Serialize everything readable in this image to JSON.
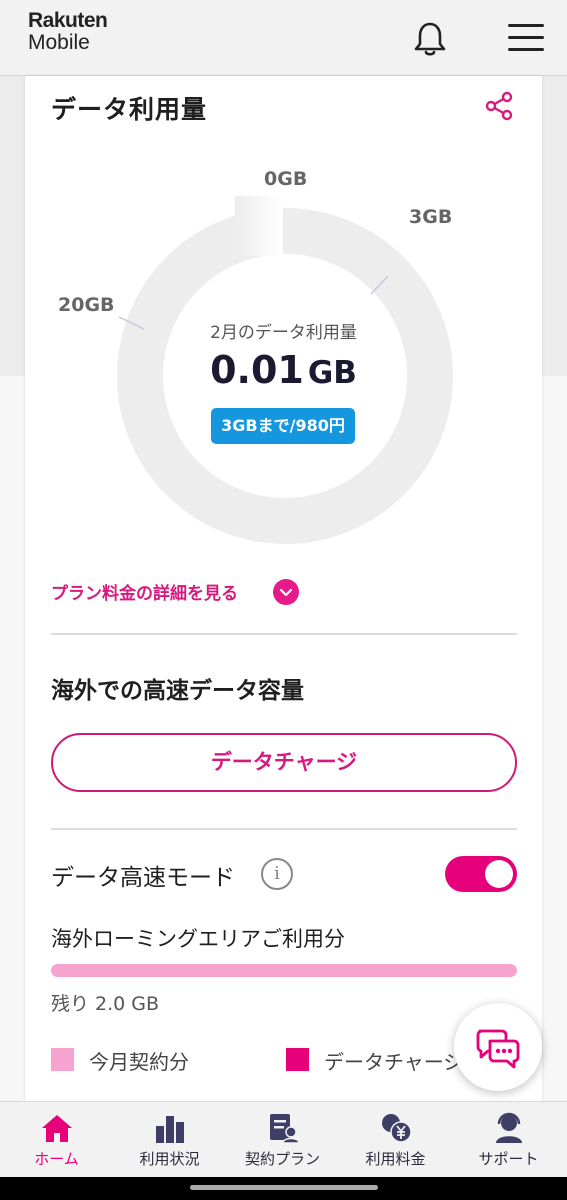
{
  "header": {
    "brand_line1": "Rakuten",
    "brand_line2": "Mobile"
  },
  "usage": {
    "title": "データ利用量",
    "label_zero": "0GB",
    "label_three": "3GB",
    "label_twenty": "20GB",
    "caption": "2月のデータ利用量",
    "value": "0.01",
    "unit": "GB",
    "price_badge": "3GBまで/980円",
    "plan_link": "プラン料金の詳細を見る"
  },
  "overseas": {
    "title": "海外での高速データ容量",
    "charge_button": "データチャージ",
    "mode_label": "データ高速モード",
    "info_glyph": "i",
    "mode_enabled": true,
    "roaming_label": "海外ローミングエリアご利用分",
    "roaming_fill_fraction": 1.0,
    "remaining": "残り 2.0 GB",
    "legend": [
      {
        "label": "今月契約分",
        "color": "#f7a3cf"
      },
      {
        "label": "データチャージ分",
        "color": "#e6007a"
      }
    ]
  },
  "colors": {
    "accent": "#e6007a",
    "badge": "#1597e0"
  },
  "nav": [
    {
      "label": "ホーム",
      "icon": "home-icon",
      "active": true
    },
    {
      "label": "利用状況",
      "icon": "bar-chart-icon",
      "active": false
    },
    {
      "label": "契約プラン",
      "icon": "contract-plan-icon",
      "active": false
    },
    {
      "label": "利用料金",
      "icon": "yen-coins-icon",
      "active": false
    },
    {
      "label": "サポート",
      "icon": "support-headset-icon",
      "active": false
    }
  ]
}
